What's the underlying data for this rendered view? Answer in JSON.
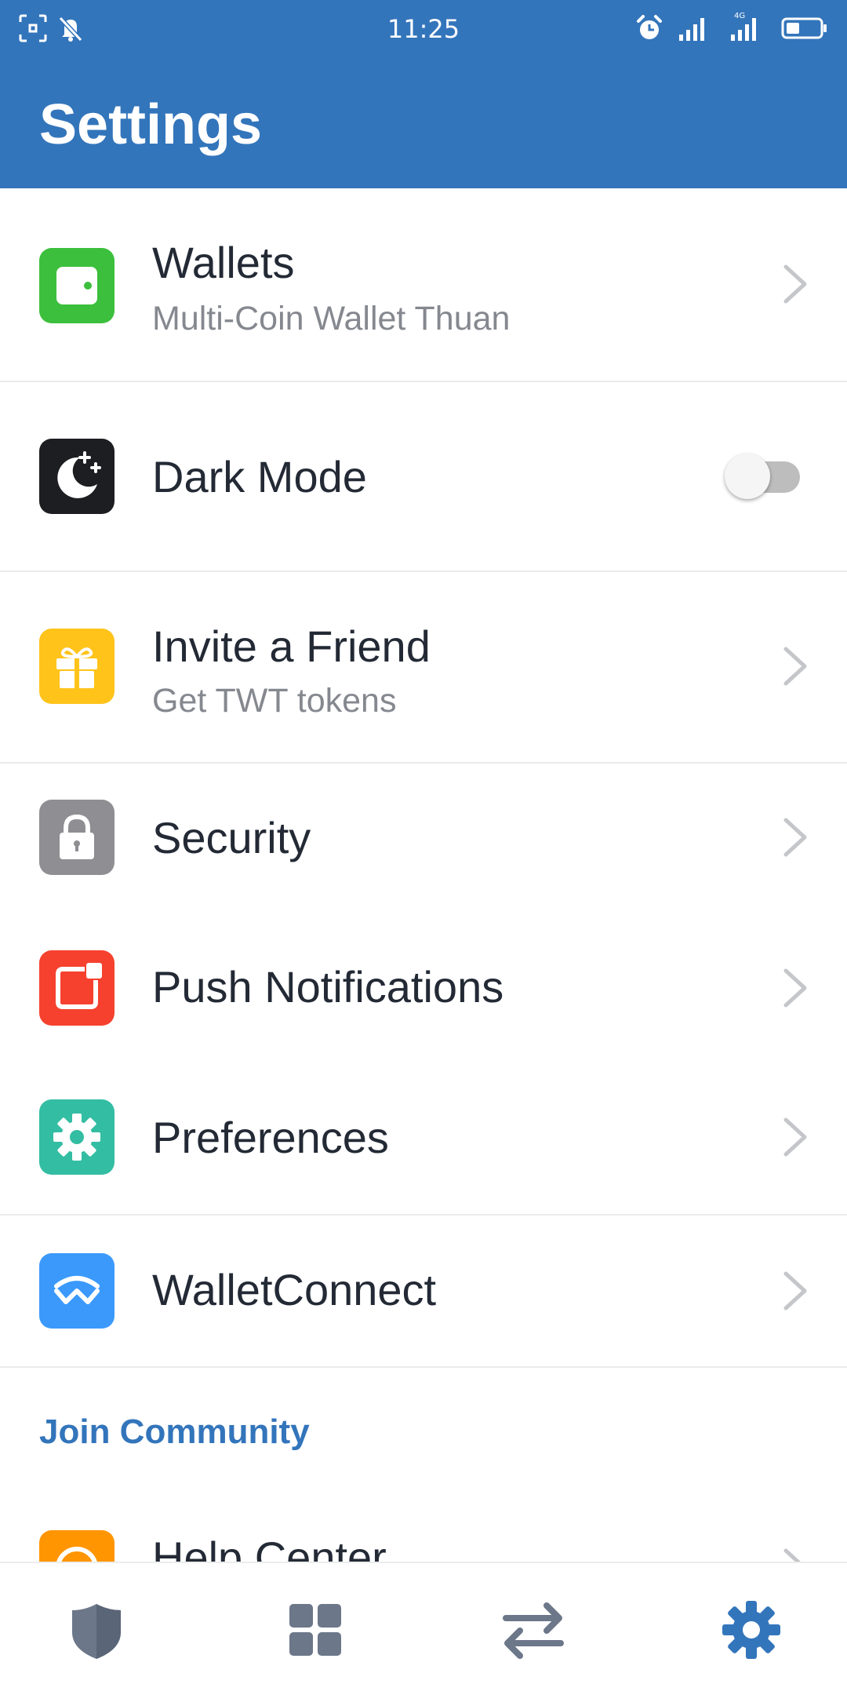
{
  "status_bar": {
    "time": "11:25",
    "icons_left": [
      "screenshot-icon",
      "bell-muted-icon"
    ],
    "icons_right": [
      "alarm-icon",
      "signal-icon",
      "signal-4g-icon",
      "battery-icon"
    ],
    "network_label": "4G"
  },
  "header": {
    "title": "Settings",
    "color": "#3375bb"
  },
  "items": [
    {
      "label": "Wallets",
      "sublabel": "Multi-Coin Wallet Thuan",
      "icon": "wallet-icon",
      "color": "#3cbf3c"
    },
    {
      "label": "Dark Mode",
      "icon": "moon-icon",
      "color": "#1d1e22",
      "toggle_on": false
    },
    {
      "label": "Invite a Friend",
      "sublabel": "Get TWT tokens",
      "icon": "gift-icon",
      "color": "#ffc31a"
    },
    {
      "label": "Security",
      "icon": "lock-icon",
      "color": "#8e8e93"
    },
    {
      "label": "Push Notifications",
      "icon": "notification-icon",
      "color": "#f5412e"
    },
    {
      "label": "Preferences",
      "icon": "gear-icon",
      "color": "#33bda3"
    },
    {
      "label": "WalletConnect",
      "icon": "walletconnect-icon",
      "color": "#3b99fc"
    }
  ],
  "section": {
    "title": "Join Community"
  },
  "partial_item": {
    "label": "Help Center",
    "icon": "help-icon",
    "color": "#ff9500"
  },
  "bottom_nav": [
    {
      "name": "wallet-tab",
      "icon": "shield-icon",
      "active": false
    },
    {
      "name": "dapps-tab",
      "icon": "grid-icon",
      "active": false
    },
    {
      "name": "dex-tab",
      "icon": "swap-icon",
      "active": false
    },
    {
      "name": "settings-tab",
      "icon": "gear-icon",
      "active": true
    }
  ],
  "colors": {
    "active": "#3375bb",
    "inactive": "#6c7789"
  }
}
